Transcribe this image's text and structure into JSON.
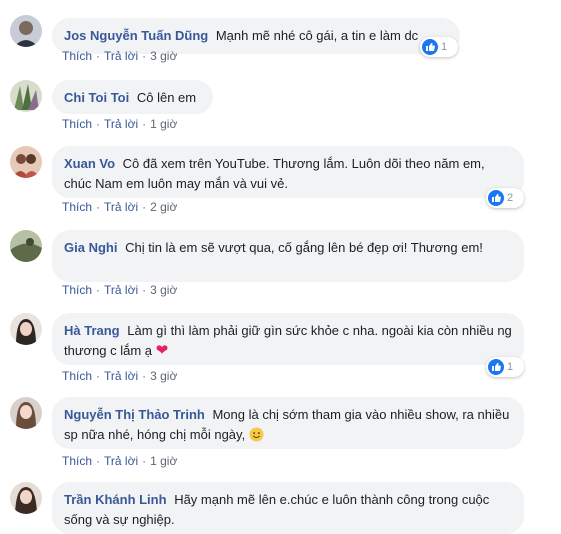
{
  "actions": {
    "like": "Thích",
    "reply": "Trả lời",
    "separator": "·"
  },
  "comments": [
    {
      "name": "Jos Nguyễn Tuấn Dũng",
      "text": "Mạnh mẽ nhé cô gái, a tin e làm dc",
      "time": "3 giờ",
      "likes": "1",
      "avatar_color": "#7a8aa0"
    },
    {
      "name": "Chi Toi Toi",
      "text": "Cô lên em",
      "time": "1 giờ",
      "likes": null,
      "avatar_color": "#6a8a5a"
    },
    {
      "name": "Xuan Vo",
      "text": "Cô đã xem trên YouTube. Thương lắm. Luôn dõi theo năm em, chúc Nam em luôn may mắn và vui vẻ.",
      "time": "2 giờ",
      "likes": "2",
      "avatar_color": "#b0483c"
    },
    {
      "name": "Gia Nghi",
      "text": "Chị tin là em sẽ vượt qua, cố gắng lên bé đẹp ơi! Thương em!",
      "time": "3 giờ",
      "likes": null,
      "avatar_color": "#5d6b4a"
    },
    {
      "name": "Hà Trang",
      "text": "Làm gì thì làm phải giữ gìn sức khỏe c nha. ngoài kia còn nhiều ng thương c lắm ạ",
      "time": "3 giờ",
      "likes": "1",
      "avatar_color": "#3a3a3a"
    },
    {
      "name": "Nguyễn Thị Thảo Trinh",
      "text": "Mong là chị sớm tham gia vào nhiều show, ra nhiều sp nữa nhé, hóng chị mỗi ngày,",
      "time": "1 giờ",
      "likes": null,
      "avatar_color": "#c9a8a0"
    },
    {
      "name": "Trần Khánh Linh",
      "text": "Hãy mạnh mẽ lên e.chúc e luôn thành công trong cuộc sống và sự nghiệp.",
      "time": null,
      "likes": null,
      "avatar_color": "#a08070"
    }
  ],
  "colors": {
    "name": "#385898",
    "bubble": "#f2f3f5",
    "meta": "#606770",
    "like_blue": "#1877f2",
    "heart": "#e0245e"
  }
}
